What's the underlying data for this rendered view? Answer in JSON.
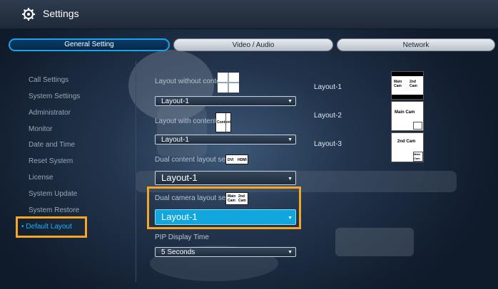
{
  "window": {
    "title": "Settings"
  },
  "tabs": [
    {
      "label": "General Setting"
    },
    {
      "label": "Video / Audio"
    },
    {
      "label": "Network"
    }
  ],
  "sidebar": {
    "items": [
      {
        "label": "Call Settings"
      },
      {
        "label": "System Settings"
      },
      {
        "label": "Administrator"
      },
      {
        "label": "Monitor"
      },
      {
        "label": "Date and Time"
      },
      {
        "label": "Reset System"
      },
      {
        "label": "License"
      },
      {
        "label": "System Update"
      },
      {
        "label": "System Restore"
      },
      {
        "label": "Default Layout"
      }
    ],
    "active_bullet": "•"
  },
  "settings": {
    "layout_without_content": {
      "label": "Layout without content",
      "value": "Layout-1"
    },
    "layout_with_content": {
      "label": "Layout with content",
      "value": "Layout-1",
      "thumb_text": "Content"
    },
    "dual_content": {
      "label": "Dual content layout setting",
      "value": "Layout-1",
      "thumb_left": "DVI",
      "thumb_right": "HDMI"
    },
    "dual_camera": {
      "label": "Dual camera layout setting",
      "value": "Layout-1",
      "thumb_left": "Main Cam",
      "thumb_right": "2nd Cam"
    },
    "pip_display_time": {
      "label": "PIP Display Time",
      "value": "5 Seconds"
    }
  },
  "layouts": [
    {
      "label": "Layout-1",
      "left": "Main Cam",
      "right": "2nd Cam"
    },
    {
      "label": "Layout-2",
      "main": "Main Cam"
    },
    {
      "label": "Layout-3",
      "main": "2nd Cam",
      "inset": "Main Cam"
    }
  ],
  "icons": {
    "settings": "gear-icon",
    "dropdown": "chevron-down-icon"
  },
  "colors": {
    "accent": "#1cb2f5",
    "highlight": "#f5a623",
    "selected_dropdown": "#11a6dd"
  }
}
